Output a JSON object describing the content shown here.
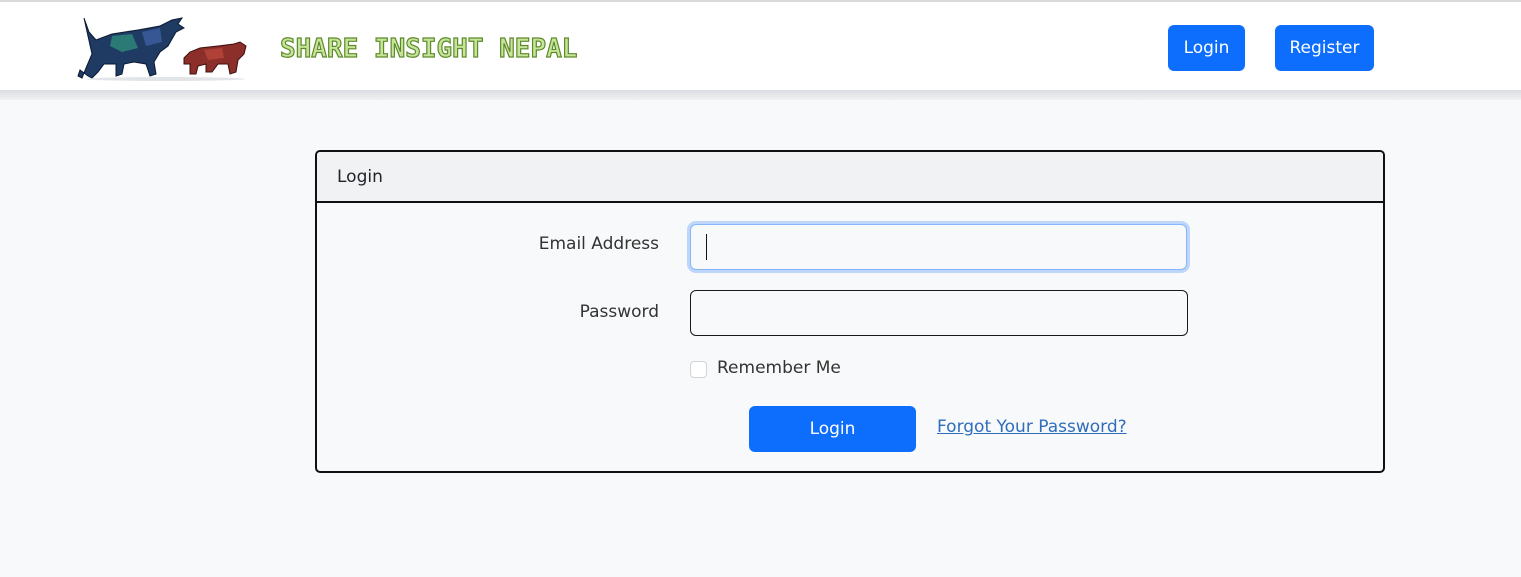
{
  "header": {
    "brand_text": "SHARE INSIGHT NEPAL",
    "login_label": "Login",
    "register_label": "Register"
  },
  "card": {
    "title": "Login",
    "email_label": "Email Address",
    "email_value": "",
    "password_label": "Password",
    "password_value": "",
    "remember_label": "Remember Me",
    "remember_checked": false,
    "submit_label": "Login",
    "forgot_label": "Forgot Your Password?"
  },
  "colors": {
    "primary": "#0d6efd",
    "link": "#2f6dbd",
    "brand_text": "#c6e59a",
    "page_bg": "#f8f9fa"
  }
}
